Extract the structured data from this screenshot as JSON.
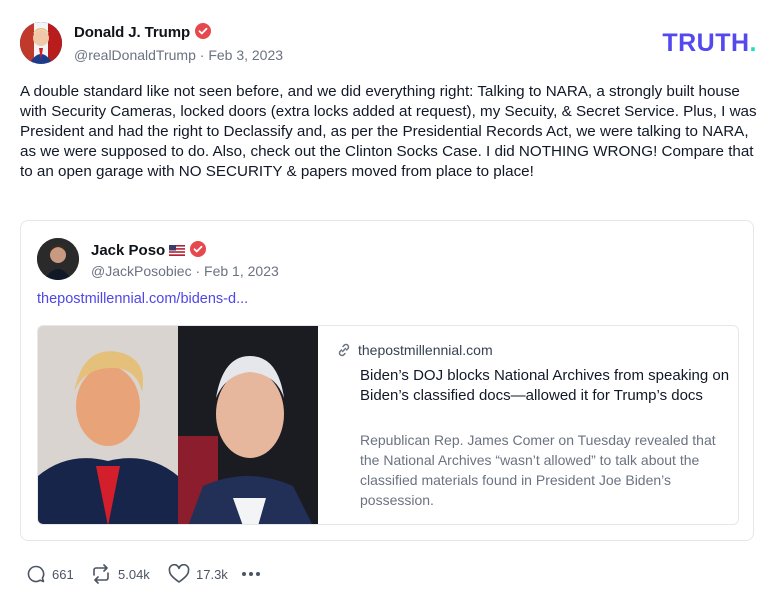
{
  "post": {
    "display_name": "Donald J. Trump",
    "handle": "@realDonaldTrump",
    "date": "Feb 3, 2023",
    "text": "A double standard like not seen before, and we did everything right: Talking to NARA, a strongly built house with Security Cameras, locked doors (extra locks added at request), my Secuity, & Secret Service. Plus, I was President and had the right to Declassify and, as per the Presidential Records Act, we were talking to NARA, as we were supposed to do. Also, check out the Clinton Socks Case. I did NOTHING WRONG! Compare that to an open garage with NO SECURITY & papers moved from place to place!"
  },
  "brand": {
    "name": "TRUTH",
    "dot": ".",
    "color": "#5448ee",
    "dot_color": "#17e2c1"
  },
  "quote": {
    "display_name": "Jack Poso",
    "handle": "@JackPosobiec",
    "date": "Feb 1, 2023",
    "link_text": "thepostmillennial.com/bidens-d...",
    "card": {
      "domain": "thepostmillennial.com",
      "title": "Biden’s DOJ blocks National Archives from speaking on Biden’s classified docs—allowed it for Trump’s docs",
      "description": "Republican Rep. James Comer on Tuesday revealed that the National Archives “wasn’t allowed” to talk about the classified materials found in President Joe Biden’s possession."
    }
  },
  "actions": {
    "replies": "661",
    "retruths": "5.04k",
    "likes": "17.3k"
  },
  "icons": [
    "verified-badge-icon",
    "us-flag-icon",
    "link-icon",
    "reply-icon",
    "retruth-icon",
    "like-icon",
    "more-icon"
  ],
  "colors": {
    "verified": "#e5484d",
    "link": "#4f46e5",
    "muted": "#6b7280"
  }
}
